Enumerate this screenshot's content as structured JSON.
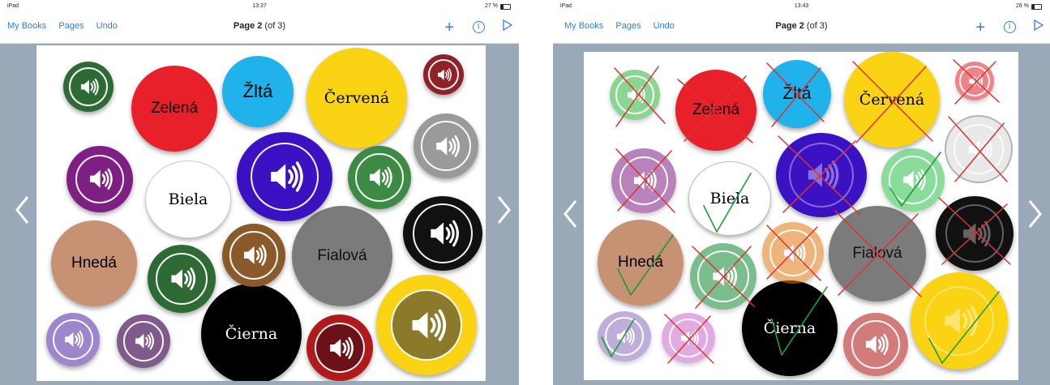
{
  "screens": [
    {
      "device": "iPad",
      "time": "13:37",
      "battery": "27 %",
      "nav": {
        "my_books": "My Books",
        "pages": "Pages",
        "undo": "Undo",
        "title_bold": "Page 2",
        "title_rest": " (of 3)"
      }
    },
    {
      "device": "iPad",
      "time": "13:43",
      "battery": "26 %",
      "nav": {
        "my_books": "My Books",
        "pages": "Pages",
        "undo": "Undo",
        "title_bold": "Page 2",
        "title_rest": " (of 3)"
      }
    }
  ],
  "words": {
    "zelena": "Zelená",
    "zlta": "Žltá",
    "cervena": "Červená",
    "biela": "Biela",
    "hneda": "Hnedá",
    "fialova": "Fialová",
    "cierna": "Čierna"
  },
  "colors": {
    "accent": "#2f7de0",
    "red": "#e8202a",
    "cyan": "#20b3eb",
    "yellow": "#fad414",
    "white": "#ffffff",
    "tan": "#c79274",
    "gray": "#7b7b7b",
    "black": "#000000",
    "green_dark": "#2e6b34",
    "maroon": "#8e2228",
    "purple": "#7d1f83",
    "blue": "#3b12c2",
    "green": "#3d8a44",
    "gray_light": "#9a9a9a",
    "brown": "#8a5a2a",
    "olive": "#8a7a2a",
    "lavender": "#9d86cc",
    "mauve": "#7e5b8a",
    "mark_red": "#e03030",
    "mark_green": "#1e9c3a"
  },
  "icons": [
    "chevron-left-icon",
    "chevron-right-icon",
    "plus-icon",
    "info-icon",
    "play-icon",
    "speaker-icon",
    "wifi-icon",
    "battery-icon"
  ]
}
